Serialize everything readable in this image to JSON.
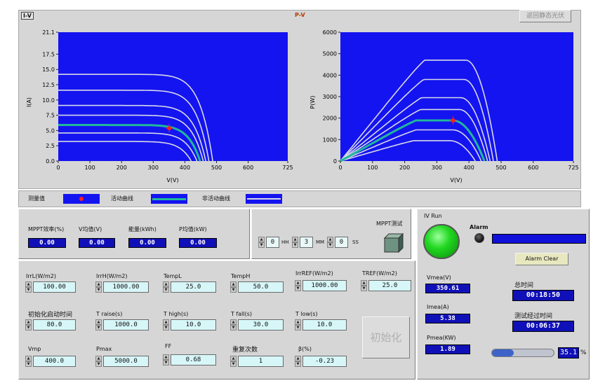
{
  "iv_chart": {
    "title": "I-V",
    "xlabel": "V(V)",
    "ylabel": "I(A)",
    "x_ticks": [
      "0",
      "100",
      "200",
      "300",
      "400",
      "500",
      "600",
      "725"
    ],
    "y_ticks": [
      "0.0",
      "2.5",
      "5.0",
      "7.5",
      "10.0",
      "12.5",
      "15.0",
      "17.5",
      "21.1"
    ]
  },
  "pv_chart": {
    "title": "P-V",
    "xlabel": "V(V)",
    "ylabel": "P(W)",
    "x_ticks": [
      "0",
      "100",
      "200",
      "300",
      "400",
      "500",
      "600",
      "725"
    ],
    "y_ticks": [
      "0",
      "1000",
      "2000",
      "3000",
      "4000",
      "5000",
      "6000"
    ]
  },
  "chart_data": [
    {
      "type": "line",
      "title": "I-V",
      "xlabel": "V(V)",
      "ylabel": "I(A)",
      "xlim": [
        0,
        725
      ],
      "ylim": [
        0,
        21.1
      ],
      "grid": false,
      "measured_point": {
        "x": 350.61,
        "y": 5.38
      },
      "series": [
        {
          "role": "inactive",
          "isc": 14.2,
          "voc": 488
        },
        {
          "role": "inactive",
          "isc": 11.6,
          "voc": 476
        },
        {
          "role": "inactive",
          "isc": 9.1,
          "voc": 466
        },
        {
          "role": "inactive",
          "isc": 7.5,
          "voc": 458
        },
        {
          "role": "active",
          "isc": 5.9,
          "voc": 448
        },
        {
          "role": "inactive",
          "isc": 4.6,
          "voc": 438
        },
        {
          "role": "inactive",
          "isc": 3.2,
          "voc": 420
        }
      ]
    },
    {
      "type": "line",
      "title": "P-V",
      "xlabel": "V(V)",
      "ylabel": "P(W)",
      "xlim": [
        0,
        725
      ],
      "ylim": [
        0,
        6000
      ],
      "grid": false,
      "measured_point": {
        "x": 350.61,
        "y": 1890
      },
      "series": [
        {
          "role": "inactive",
          "pmax": 4700,
          "vmp": 390,
          "voc": 488
        },
        {
          "role": "inactive",
          "pmax": 3800,
          "vmp": 385,
          "voc": 476
        },
        {
          "role": "inactive",
          "pmax": 2950,
          "vmp": 375,
          "voc": 466
        },
        {
          "role": "inactive",
          "pmax": 2400,
          "vmp": 370,
          "voc": 458
        },
        {
          "role": "active",
          "pmax": 1890,
          "vmp": 350,
          "voc": 448
        },
        {
          "role": "inactive",
          "pmax": 1450,
          "vmp": 350,
          "voc": 438
        },
        {
          "role": "inactive",
          "pmax": 950,
          "vmp": 340,
          "voc": 420
        }
      ]
    }
  ],
  "colors": {
    "plot_bg": "#1414f0",
    "inactive_curve": "#d8d8e8",
    "active_curve": "#20b89a",
    "marker": "#ff2020",
    "indicator": "#1010b8",
    "control": "#d7f6f8",
    "led_on": "#22d822"
  },
  "top_button": "返回静态光伏",
  "legend": {
    "measured": "测量值",
    "active": "活动曲线",
    "inactive": "非活动曲线"
  },
  "stats": [
    {
      "label": "MPPT效率(%)",
      "value": "0.00"
    },
    {
      "label": "V均值(V)",
      "value": "0.00"
    },
    {
      "label": "能量(kWh)",
      "value": "0.00"
    },
    {
      "label": "P均值(kW)",
      "value": "0.00"
    }
  ],
  "mppt": {
    "label": "MPPT测试",
    "hh": "0",
    "hh_unit": "HH",
    "mm": "3",
    "mm_unit": "MM",
    "ss": "0",
    "ss_unit": "SS"
  },
  "params": {
    "irrl": {
      "label": "IrrL(W/m2)",
      "value": "100.00"
    },
    "irrh": {
      "label": "IrrH(W/m2)",
      "value": "1000.00"
    },
    "templ": {
      "label": "TempL",
      "value": "25.0"
    },
    "temph": {
      "label": "TempH",
      "value": "50.0"
    },
    "irrref": {
      "label": "IrrREF(W/m2)",
      "value": "1000.00"
    },
    "tref": {
      "label": "TREF(W/m2)",
      "value": "25.0"
    },
    "init_start": {
      "label": "初始化启动时间",
      "value": "80.0"
    },
    "t_raise": {
      "label": "T raise(s)",
      "value": "1000.0"
    },
    "t_high": {
      "label": "T high(s)",
      "value": "10.0"
    },
    "t_fall": {
      "label": "T fall(s)",
      "value": "30.0"
    },
    "t_low": {
      "label": "T low(s)",
      "value": "10.0"
    },
    "vmp": {
      "label": "Vmp",
      "value": "400.0"
    },
    "pmax": {
      "label": "Pmax",
      "value": "5000.0"
    },
    "ff": {
      "label": "FF",
      "value": "0.68"
    },
    "repeat": {
      "label": "重复次数",
      "value": "1"
    },
    "beta": {
      "label": "β(%)",
      "value": "-0.23"
    }
  },
  "init_button": "初始化",
  "right": {
    "iv_run": "IV Run",
    "alarm": "Alarm",
    "alarm_clear": "Alarm Clear",
    "vmea": {
      "label": "Vmea(V)",
      "value": "350.61"
    },
    "imea": {
      "label": "Imea(A)",
      "value": "5.38"
    },
    "pmea": {
      "label": "Pmea(KW)",
      "value": "1.89"
    },
    "total_time": {
      "label": "总时间",
      "value": "00:18:50"
    },
    "elapsed_time": {
      "label": "测试经过时间",
      "value": "00:06:37"
    },
    "progress": {
      "value": "35.1",
      "unit": "%",
      "fraction": 0.351
    }
  }
}
